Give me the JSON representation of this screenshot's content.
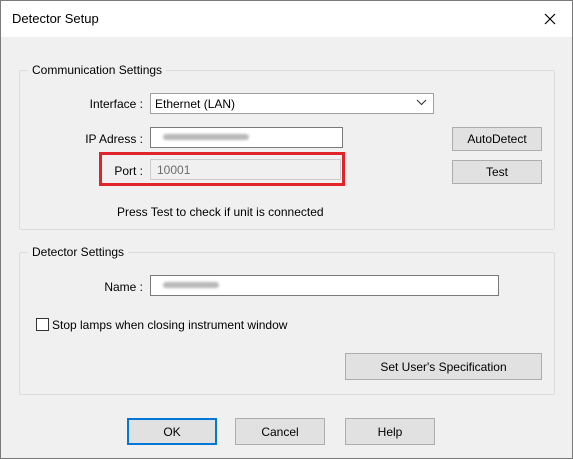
{
  "window": {
    "title": "Detector Setup",
    "close_icon": "close-icon"
  },
  "communication": {
    "group_title": "Communication Settings",
    "interface_label": "Interface :",
    "interface_value": "Ethernet (LAN)",
    "ip_label": "IP Adress :",
    "port_label": "Port :",
    "port_value": "10001",
    "autodetect_label": "AutoDetect",
    "test_label": "Test",
    "hint": "Press Test to check if unit is connected"
  },
  "detector": {
    "group_title": "Detector Settings",
    "name_label": "Name :",
    "stop_lamps_label": "Stop lamps when closing instrument window",
    "stop_lamps_checked": false,
    "spec_button_label": "Set User's Specification"
  },
  "footer": {
    "ok_label": "OK",
    "cancel_label": "Cancel",
    "help_label": "Help"
  },
  "colors": {
    "highlight": "#e0242a",
    "accent": "#0078d7"
  }
}
